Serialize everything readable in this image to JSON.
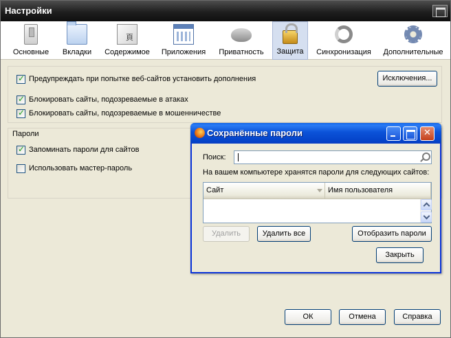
{
  "window": {
    "title": "Настройки"
  },
  "toolbar": {
    "items": [
      {
        "label": "Основные",
        "icon": "general-switch-icon"
      },
      {
        "label": "Вкладки",
        "icon": "tabs-folder-icon"
      },
      {
        "label": "Содержимое",
        "icon": "content-icon"
      },
      {
        "label": "Приложения",
        "icon": "applications-icon"
      },
      {
        "label": "Приватность",
        "icon": "privacy-mask-icon"
      },
      {
        "label": "Защита",
        "icon": "security-lock-icon",
        "active": true
      },
      {
        "label": "Синхронизация",
        "icon": "sync-icon"
      },
      {
        "label": "Дополнительные",
        "icon": "advanced-gear-icon"
      }
    ]
  },
  "security": {
    "warn_addons_label": "Предупреждать при попытке веб-сайтов установить дополнения",
    "exceptions_button": "Исключения...",
    "block_attack_label": "Блокировать сайты, подозреваемые в атаках",
    "block_forgery_label": "Блокировать сайты, подозреваемые в мошенничестве"
  },
  "passwords": {
    "group_label": "Пароли",
    "remember_label": "Запоминать пароли для сайтов",
    "master_label": "Использовать мастер-пароль"
  },
  "dialog": {
    "title": "Сохранённые пароли",
    "search_label": "Поиск:",
    "search_value": "",
    "info_text": "На вашем компьютере хранятся пароли для следующих сайтов:",
    "columns": [
      "Сайт",
      "Имя пользователя"
    ],
    "rows": [],
    "remove_button": "Удалить",
    "remove_all_button": "Удалить все",
    "show_passwords_button": "Отобразить пароли",
    "close_button": "Закрыть"
  },
  "footer": {
    "ok_button": "ОК",
    "cancel_button": "Отмена",
    "help_button": "Справка"
  }
}
